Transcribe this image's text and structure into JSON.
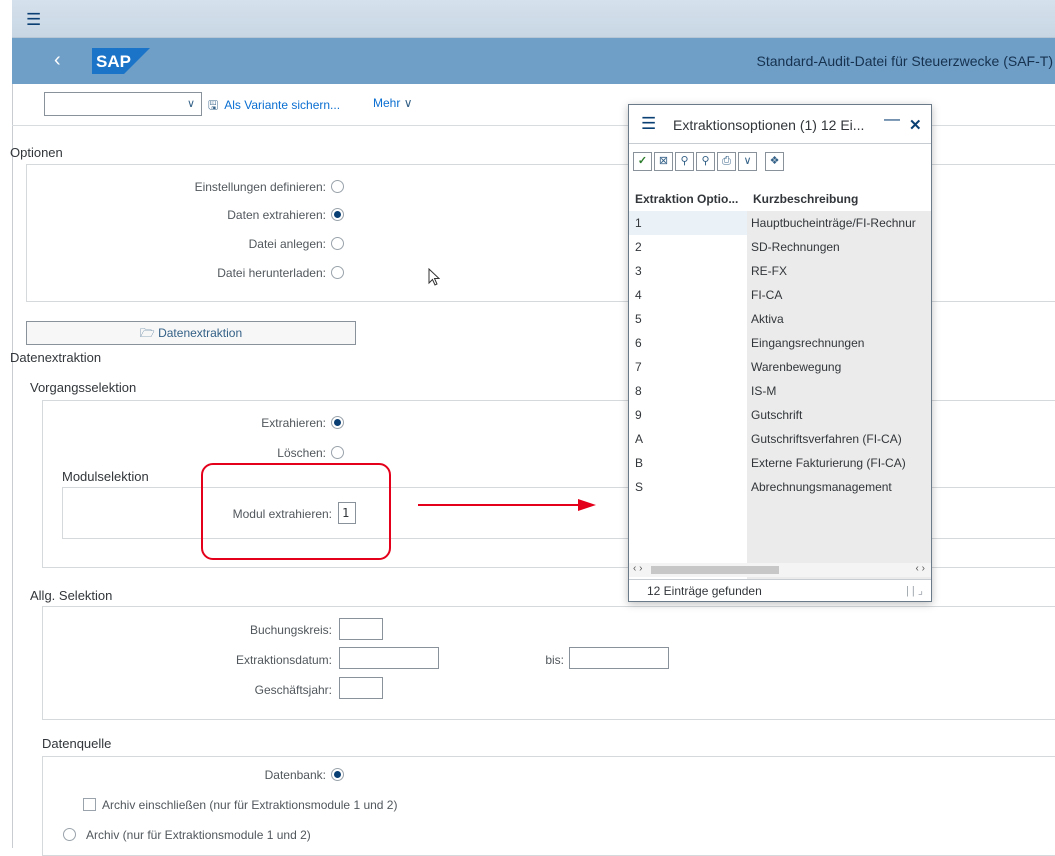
{
  "window": {
    "title": "Standard-Audit-Datei für Steuerzwecke (SAF-T)",
    "logo_text": "SAP"
  },
  "toolbar": {
    "variant_value": "",
    "save_variant_label": "Als Variante sichern...",
    "more_label": "Mehr"
  },
  "options": {
    "heading": "Optionen",
    "items": [
      {
        "label": "Einstellungen definieren:",
        "selected": false
      },
      {
        "label": "Daten extrahieren:",
        "selected": true
      },
      {
        "label": "Datei anlegen:",
        "selected": false
      },
      {
        "label": "Datei herunterladen:",
        "selected": false
      }
    ]
  },
  "extraction_button": {
    "label": "Datenextraktion"
  },
  "datenextraktion": {
    "heading": "Datenextraktion",
    "vorgang": {
      "heading": "Vorgangsselektion",
      "extrahieren_label": "Extrahieren:",
      "loeschen_label": "Löschen:"
    },
    "modul": {
      "heading": "Modulselektion",
      "label": "Modul extrahieren:",
      "value": "1"
    }
  },
  "allg": {
    "heading": "Allg. Selektion",
    "buchungskreis_label": "Buchungskreis:",
    "datum_label": "Extraktionsdatum:",
    "bis_label": "bis:",
    "jahr_label": "Geschäftsjahr:"
  },
  "datenquelle": {
    "heading": "Datenquelle",
    "datenbank_label": "Datenbank:",
    "archiv_einschl_label": "Archiv einschließen (nur für Extraktionsmodule 1 und 2)",
    "archiv_label": "Archiv (nur für Extraktionsmodule 1 und 2)"
  },
  "popup": {
    "title": "Extraktionsoptionen (1)  12 Ei...",
    "col1": "Extraktion Optio...",
    "col2": "Kurzbeschreibung",
    "rows": [
      {
        "key": "1",
        "text": "Hauptbucheinträge/FI-Rechnur"
      },
      {
        "key": "2",
        "text": "SD-Rechnungen"
      },
      {
        "key": "3",
        "text": "RE-FX"
      },
      {
        "key": "4",
        "text": "FI-CA"
      },
      {
        "key": "5",
        "text": "Aktiva"
      },
      {
        "key": "6",
        "text": "Eingangsrechnungen"
      },
      {
        "key": "7",
        "text": "Warenbewegung"
      },
      {
        "key": "8",
        "text": "IS-M"
      },
      {
        "key": "9",
        "text": "Gutschrift"
      },
      {
        "key": "A",
        "text": "Gutschriftsverfahren (FI-CA)"
      },
      {
        "key": "B",
        "text": "Externe Fakturierung (FI-CA)"
      },
      {
        "key": "S",
        "text": "Abrechnungsmanagement"
      }
    ],
    "status": "12 Einträge gefunden"
  },
  "colors": {
    "accent": "#0a6ed1",
    "shell": "#6f9ec7",
    "highlight": "#e4001b"
  }
}
